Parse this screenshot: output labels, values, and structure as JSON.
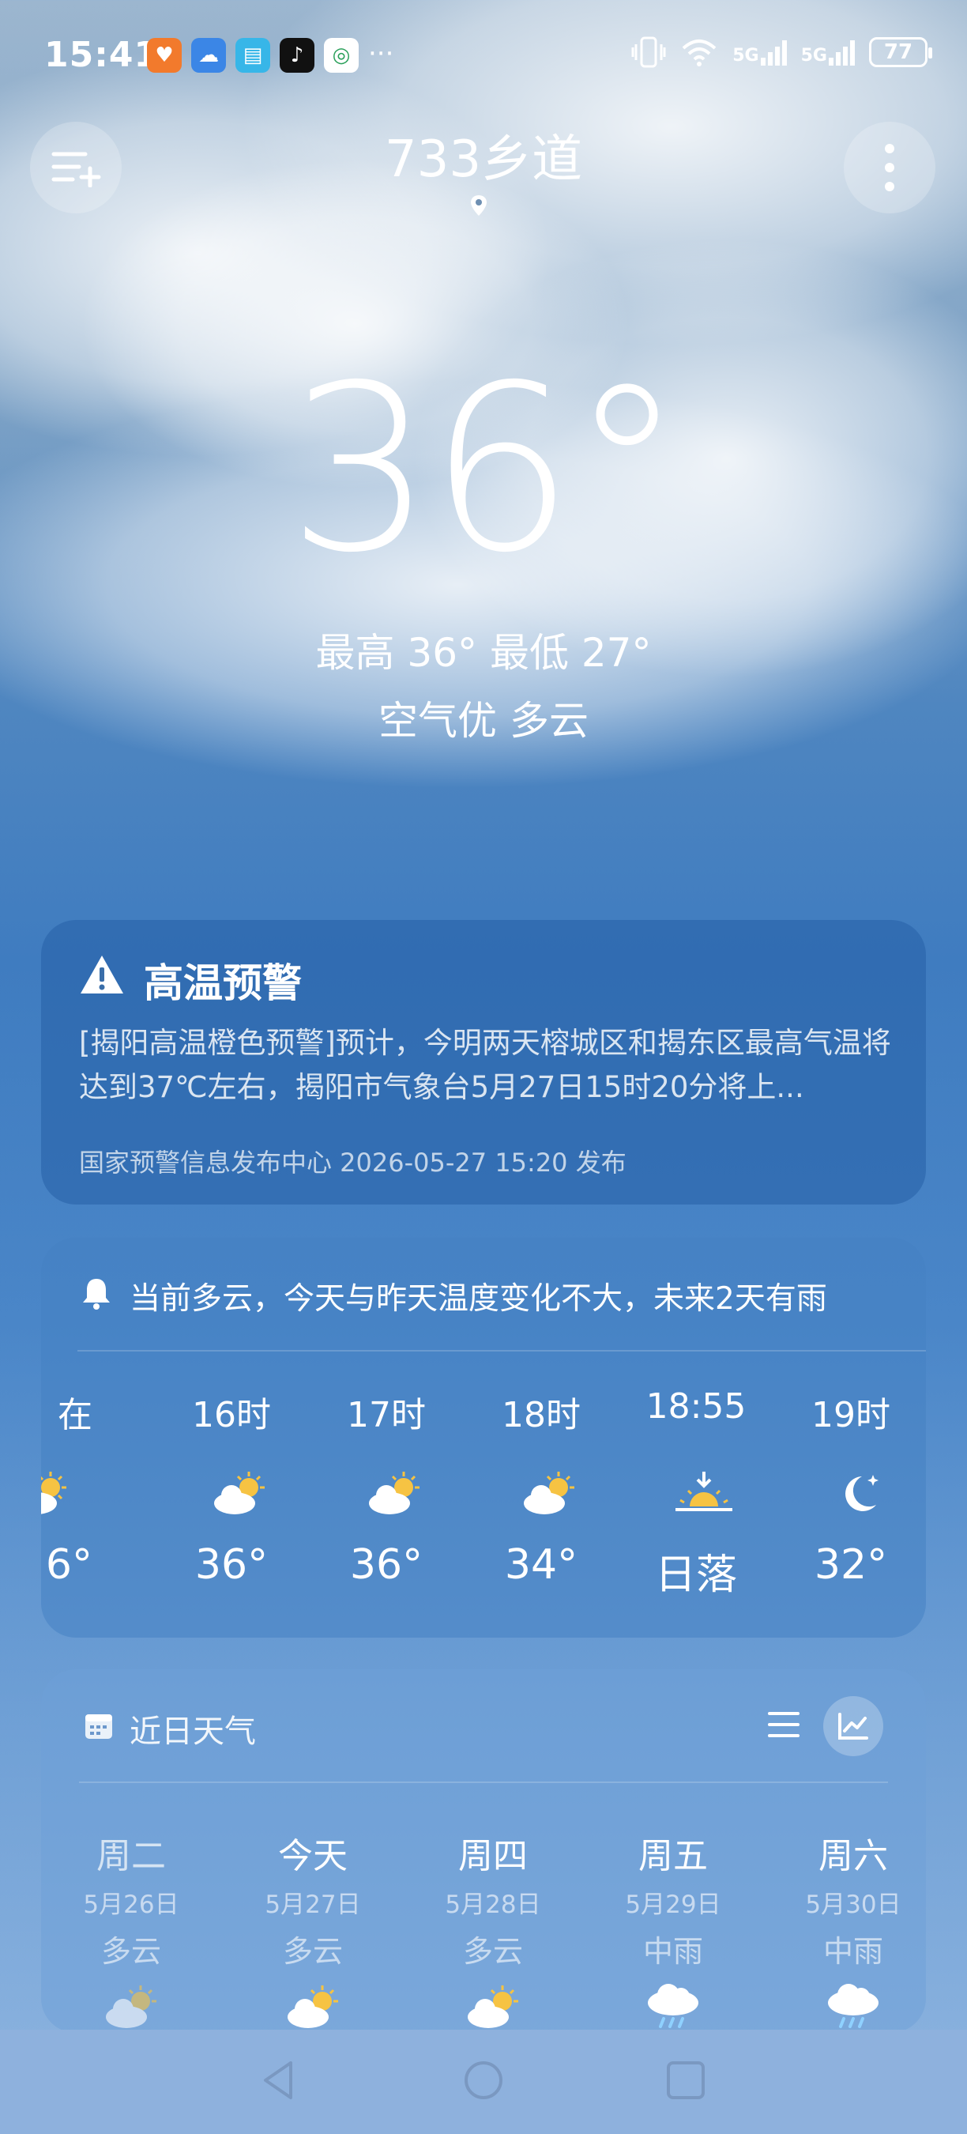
{
  "status_bar": {
    "time": "15:41",
    "more": "···",
    "network_1": "5G",
    "network_2": "5G",
    "battery": "77"
  },
  "header": {
    "city": "733乡道"
  },
  "current": {
    "temperature": "36°",
    "high_low": "最高 36° 最低 27°",
    "air_and_condition": "空气优  多云"
  },
  "warning": {
    "title": "高温预警",
    "body": "[揭阳高温橙色预警]预计，今明两天榕城区和揭东区最高气温将达到37℃左右，揭阳市气象台5月27日15时20分将上...",
    "source": "国家预警信息发布中心 2026-05-27 15:20 发布"
  },
  "hourly": {
    "summary": "当前多云，今天与昨天温度变化不大，未来2天有雨",
    "items": [
      {
        "time": "在",
        "icon": "partly-cloudy-sun-icon",
        "value": "6°"
      },
      {
        "time": "16时",
        "icon": "partly-cloudy-sun-icon",
        "value": "36°"
      },
      {
        "time": "17时",
        "icon": "partly-cloudy-sun-icon",
        "value": "36°"
      },
      {
        "time": "18时",
        "icon": "partly-cloudy-sun-icon",
        "value": "34°"
      },
      {
        "time": "18:55",
        "icon": "sunset-icon",
        "value": "日落"
      },
      {
        "time": "19时",
        "icon": "moon-star-icon",
        "value": "32°"
      }
    ]
  },
  "daily": {
    "title": "近日天气",
    "days": [
      {
        "day": "周二",
        "date": "5月26日",
        "weather": "多云",
        "icon": "partly-cloudy-sun-icon"
      },
      {
        "day": "今天",
        "date": "5月27日",
        "weather": "多云",
        "icon": "partly-cloudy-sun-icon"
      },
      {
        "day": "周四",
        "date": "5月28日",
        "weather": "多云",
        "icon": "partly-cloudy-sun-icon"
      },
      {
        "day": "周五",
        "date": "5月29日",
        "weather": "中雨",
        "icon": "rain-cloud-icon"
      },
      {
        "day": "周六",
        "date": "5月30日",
        "weather": "中雨",
        "icon": "rain-cloud-icon"
      }
    ]
  },
  "colors": {
    "sun": "#f6c343",
    "cloud": "#ffffff",
    "rain": "#8fd1ff"
  }
}
